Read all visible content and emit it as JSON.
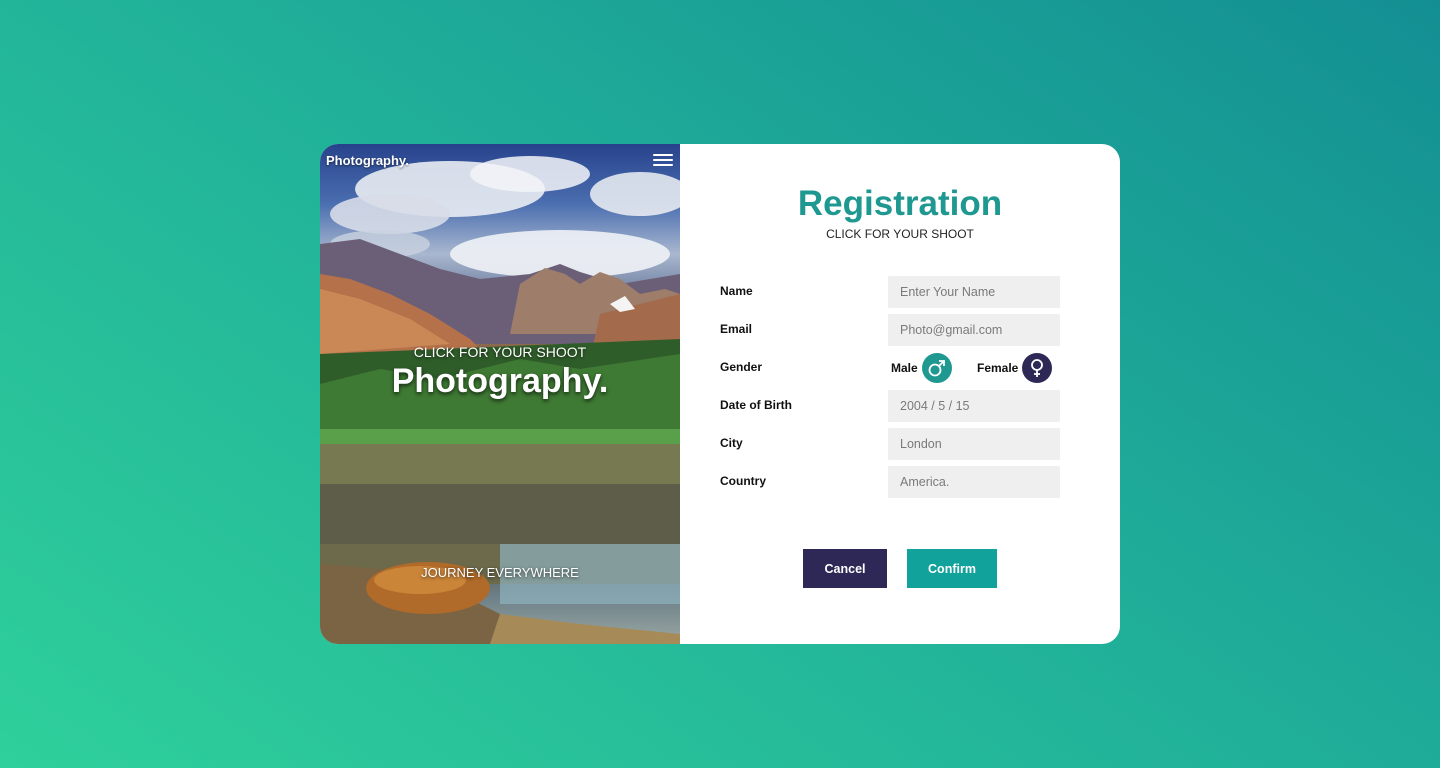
{
  "photo_panel": {
    "brand": "Photography.",
    "hero_subtitle": "CLICK FOR YOUR SHOOT",
    "hero_title": "Photography.",
    "tagline": "JOURNEY EVERYWHERE",
    "icons": {
      "menu": "hamburger-menu-icon"
    }
  },
  "form": {
    "title": "Registration",
    "subtitle": "CLICK FOR YOUR SHOOT",
    "fields": {
      "name": {
        "label": "Name",
        "placeholder": "Enter Your Name"
      },
      "email": {
        "label": "Email",
        "placeholder": "Photo@gmail.com"
      },
      "gender": {
        "label": "Gender",
        "male_label": "Male",
        "female_label": "Female",
        "male_icon": "male-symbol-icon",
        "female_icon": "female-symbol-icon"
      },
      "dob": {
        "label": "Date of Birth",
        "placeholder": "2004 / 5 / 15"
      },
      "city": {
        "label": "City",
        "placeholder": "London"
      },
      "country": {
        "label": "Country",
        "placeholder": "America."
      }
    },
    "buttons": {
      "cancel": "Cancel",
      "confirm": "Confirm"
    }
  },
  "colors": {
    "accent_teal": "#1e9890",
    "confirm_button": "#12a29c",
    "dark_indigo": "#2e2857",
    "input_bg": "#efefef"
  }
}
